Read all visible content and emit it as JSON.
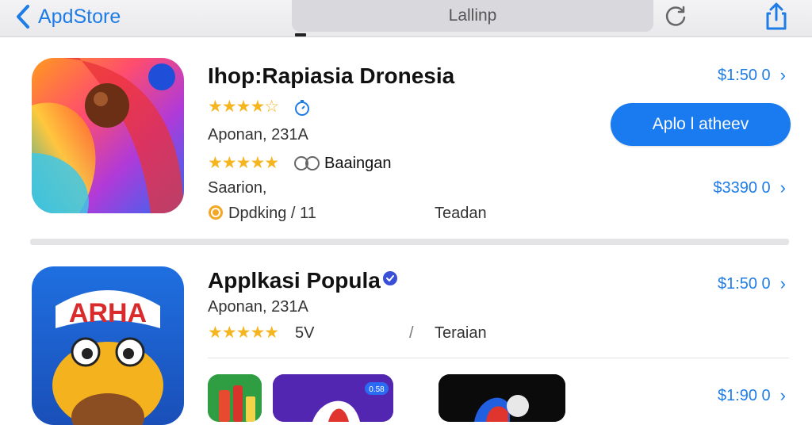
{
  "topbar": {
    "back_label": "ApdStore",
    "search_text": "Lallinp"
  },
  "apps": [
    {
      "title": "Ihop:Rapiasia Dronesia",
      "meta1": "Aponan, 231A",
      "meta2": "Saarion,",
      "review_label": "Baaingan",
      "info_label": "Dpdking / 11",
      "category": "Teadan",
      "price_top": "$1:50 0",
      "price_bottom": "$3390 0",
      "button_label": "Aplo l atheev",
      "rating": 4.5
    },
    {
      "title": "Applkasi Popula",
      "meta1": "Aponan, 231A",
      "count": "5V",
      "slash": "/",
      "category": "Teraian",
      "price_top": "$1:50 0",
      "price_bottom": "$1:90 0",
      "rating": 5,
      "icon_text": "ARHA",
      "thumb_badge": "0.58"
    }
  ],
  "colors": {
    "accent": "#1a7bf0",
    "link": "#1e7ce6",
    "star": "#f5b51f"
  }
}
